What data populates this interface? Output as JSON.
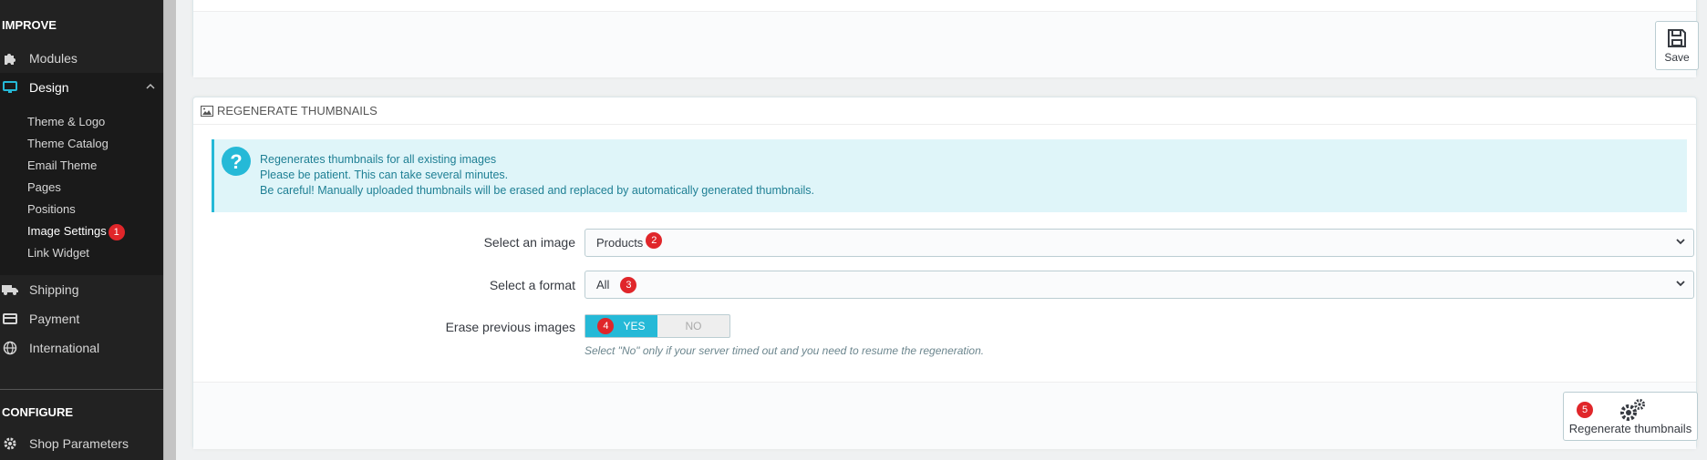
{
  "sidebar": {
    "improve_label": "IMPROVE",
    "configure_label": "CONFIGURE",
    "items": {
      "modules": "Modules",
      "design": "Design",
      "shipping": "Shipping",
      "payment": "Payment",
      "international": "International",
      "shop_parameters": "Shop Parameters"
    },
    "design_sub": {
      "theme_logo": "Theme & Logo",
      "theme_catalog": "Theme Catalog",
      "email_theme": "Email Theme",
      "pages": "Pages",
      "positions": "Positions",
      "image_settings": "Image Settings",
      "link_widget": "Link Widget"
    }
  },
  "top_panel": {
    "save_label": "Save"
  },
  "regen_panel": {
    "heading": "REGENERATE THUMBNAILS",
    "alert_lines": [
      "Regenerates thumbnails for all existing images",
      "Please be patient. This can take several minutes.",
      "Be careful! Manually uploaded thumbnails will be erased and replaced by automatically generated thumbnails."
    ],
    "select_image_label": "Select an image",
    "select_image_value": "Products",
    "select_format_label": "Select a format",
    "select_format_value": "All",
    "erase_label": "Erase previous images",
    "erase_yes": "YES",
    "erase_no": "NO",
    "erase_help": "Select \"No\" only if your server timed out and you need to resume the regeneration.",
    "regen_button_label": "Regenerate thumbnails"
  },
  "badges": {
    "image_settings": "1",
    "select_image": "2",
    "select_format": "3",
    "erase": "4",
    "regen": "5"
  },
  "colors": {
    "accent": "#25b9d7",
    "badge": "#e0262a",
    "sidebar_bg": "#222222"
  },
  "icons": {
    "modules": "puzzle-icon",
    "design": "monitor-icon",
    "shipping": "truck-icon",
    "payment": "credit-card-icon",
    "international": "globe-icon",
    "shop_parameters": "gear-icon"
  }
}
